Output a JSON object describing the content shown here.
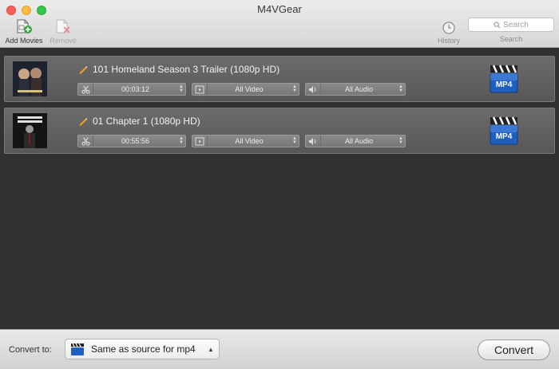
{
  "window": {
    "title": "M4VGear"
  },
  "toolbar": {
    "add_label": "Add Movies",
    "remove_label": "Remove",
    "history_label": "History",
    "search_placeholder": "Search",
    "search_caption": "Search"
  },
  "movies": [
    {
      "title": "101 Homeland Season 3 Trailer (1080p HD)",
      "duration": "00:03:12",
      "video": "All Video",
      "audio": "All Audio",
      "format_badge": "MP4"
    },
    {
      "title": "01 Chapter 1 (1080p HD)",
      "duration": "00:55:56",
      "video": "All Video",
      "audio": "All Audio",
      "format_badge": "MP4"
    }
  ],
  "bottom": {
    "convert_to_label": "Convert to:",
    "format_value": "Same as source for mp4",
    "convert_button": "Convert"
  },
  "colors": {
    "accent_blue": "#1f5fbf",
    "row_bg": "#626262",
    "list_bg": "#323232"
  }
}
